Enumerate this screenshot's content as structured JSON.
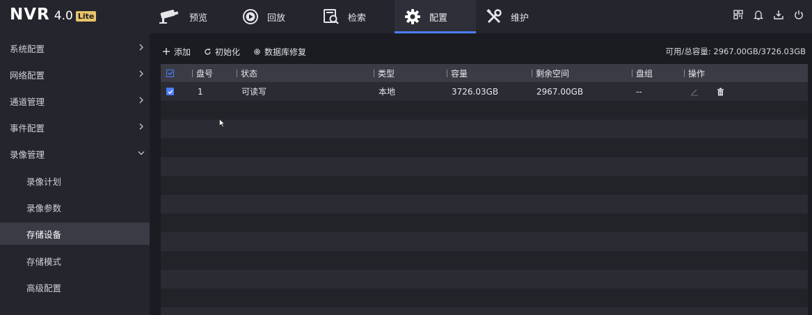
{
  "app": {
    "name": "NVR",
    "version": "4.0",
    "edition": "Lite"
  },
  "colors": {
    "accent": "#4d7cfe",
    "background": "#1b1c22",
    "panel": "#24252d",
    "header": "#3a3b44",
    "badge": "#e8c36a"
  },
  "nav": {
    "tabs": [
      {
        "label": "预览",
        "icon": "camera-icon"
      },
      {
        "label": "回放",
        "icon": "playback-icon"
      },
      {
        "label": "检索",
        "icon": "search-file-icon"
      },
      {
        "label": "配置",
        "icon": "gear-icon",
        "active": true
      },
      {
        "label": "维护",
        "icon": "tools-icon"
      }
    ],
    "right_icons": [
      "qr-code-icon",
      "bell-icon",
      "download-icon",
      "power-icon"
    ]
  },
  "sidebar": {
    "items": [
      {
        "label": "系统配置",
        "level": 1,
        "arrow": "right"
      },
      {
        "label": "网络配置",
        "level": 1,
        "arrow": "right"
      },
      {
        "label": "通道管理",
        "level": 1,
        "arrow": "right"
      },
      {
        "label": "事件配置",
        "level": 1,
        "arrow": "right"
      },
      {
        "label": "录像管理",
        "level": 1,
        "arrow": "down"
      },
      {
        "label": "录像计划",
        "level": 2
      },
      {
        "label": "录像参数",
        "level": 2
      },
      {
        "label": "存储设备",
        "level": 2,
        "selected": true
      },
      {
        "label": "存储模式",
        "level": 2
      },
      {
        "label": "高级配置",
        "level": 2
      }
    ]
  },
  "toolbar": {
    "add_label": "添加",
    "init_label": "初始化",
    "repair_label": "数据库修复",
    "capacity_label": "可用/总容量: 2967.00GB/3726.03GB"
  },
  "table": {
    "columns": [
      "盘号",
      "状态",
      "类型",
      "容量",
      "剩余空间",
      "盘组",
      "操作"
    ],
    "rows": [
      {
        "checked": true,
        "disk_no": "1",
        "status": "可读写",
        "type": "本地",
        "capacity": "3726.03GB",
        "free": "2967.00GB",
        "group": "--"
      }
    ]
  }
}
